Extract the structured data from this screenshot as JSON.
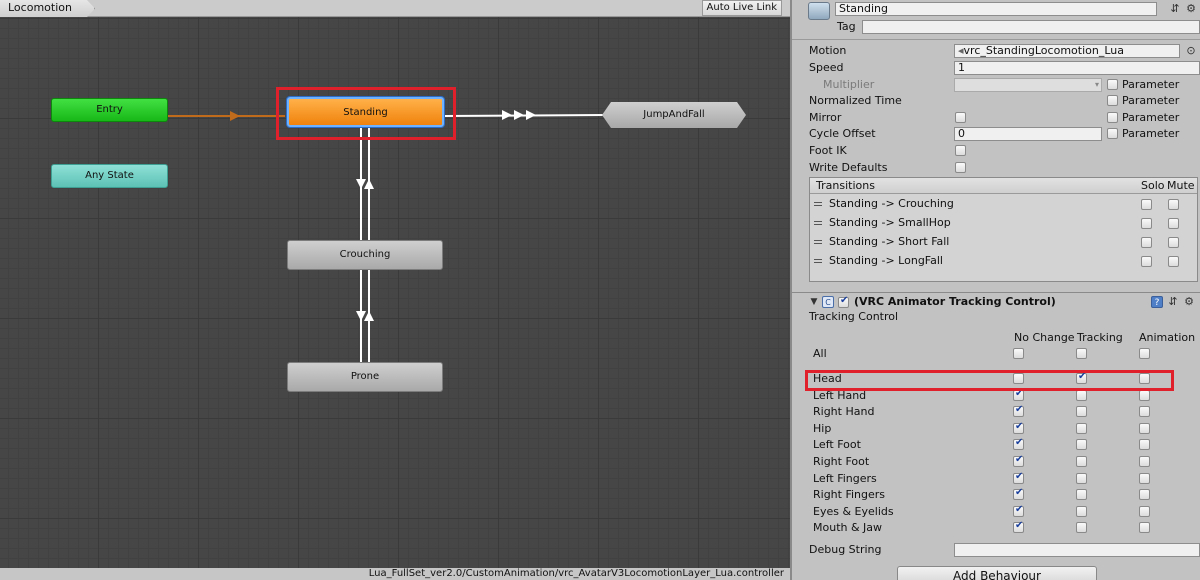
{
  "graph": {
    "breadcrumb": "Locomotion",
    "live_link_label": "Auto Live Link",
    "nodes": {
      "entry": "Entry",
      "any_state": "Any State",
      "standing": "Standing",
      "jump_and_fall": "JumpAndFall",
      "crouching": "Crouching",
      "prone": "Prone"
    },
    "status_path": "Lua_FullSet_ver2.0/CustomAnimation/vrc_AvatarV3LocomotionLayer_Lua.controller",
    "colors": {
      "entry": "#22c422",
      "any_state": "#6fcdbf",
      "standing": "#f39322",
      "highlight": "#e0202a",
      "transition_default": "#c06a1c",
      "transition": "#ffffff"
    }
  },
  "inspector": {
    "state_name": "Standing",
    "tag_label": "Tag",
    "tag_value": "",
    "rows": {
      "motion_label": "Motion",
      "motion_value": "vrc_StandingLocomotion_Lua",
      "speed_label": "Speed",
      "speed_value": "1",
      "multiplier_label": "Multiplier",
      "normalized_time_label": "Normalized Time",
      "mirror_label": "Mirror",
      "cycle_offset_label": "Cycle Offset",
      "cycle_offset_value": "0",
      "foot_ik_label": "Foot IK",
      "write_defaults_label": "Write Defaults",
      "parameter_label": "Parameter"
    },
    "transitions": {
      "header": "Transitions",
      "solo_label": "Solo",
      "mute_label": "Mute",
      "items": [
        "Standing -> Crouching",
        "Standing -> SmallHop",
        "Standing -> Short Fall",
        "Standing -> LongFall"
      ]
    },
    "component": {
      "title": "(VRC Animator Tracking Control)",
      "enabled": true,
      "section_label": "Tracking Control",
      "col_no_change": "No Change",
      "col_tracking": "Tracking",
      "col_animation": "Animation",
      "rows": [
        {
          "label": "All",
          "no_change": false,
          "tracking": false,
          "animation": false
        },
        {
          "label": "Head",
          "no_change": false,
          "tracking": true,
          "animation": false
        },
        {
          "label": "Left Hand",
          "no_change": true,
          "tracking": false,
          "animation": false
        },
        {
          "label": "Right Hand",
          "no_change": true,
          "tracking": false,
          "animation": false
        },
        {
          "label": "Hip",
          "no_change": true,
          "tracking": false,
          "animation": false
        },
        {
          "label": "Left Foot",
          "no_change": true,
          "tracking": false,
          "animation": false
        },
        {
          "label": "Right Foot",
          "no_change": true,
          "tracking": false,
          "animation": false
        },
        {
          "label": "Left Fingers",
          "no_change": true,
          "tracking": false,
          "animation": false
        },
        {
          "label": "Right Fingers",
          "no_change": true,
          "tracking": false,
          "animation": false
        },
        {
          "label": "Eyes & Eyelids",
          "no_change": true,
          "tracking": false,
          "animation": false
        },
        {
          "label": "Mouth & Jaw",
          "no_change": true,
          "tracking": false,
          "animation": false
        }
      ],
      "debug_label": "Debug String",
      "debug_value": ""
    },
    "add_behaviour_label": "Add Behaviour",
    "icons": {
      "state": "state-icon",
      "motion": "motion-clip-icon",
      "target": "target-picker-icon",
      "layout": "layout-icon",
      "gear": "gear-icon",
      "help": "help-icon",
      "script": "script-icon",
      "foldout": "foldout-arrow-icon"
    }
  }
}
